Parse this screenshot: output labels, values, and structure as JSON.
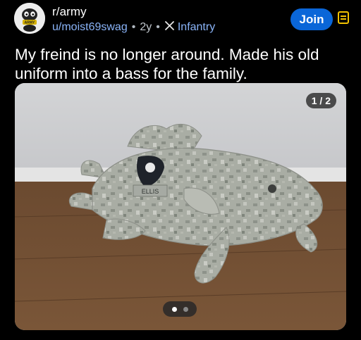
{
  "post": {
    "subreddit": "r/army",
    "author": "u/moist69swag",
    "separator": "•",
    "age": "2y",
    "flair": "Infantry",
    "title": "My freind is no longer around. Made his old uniform into a bass for the family.",
    "join_label": "Join"
  },
  "media": {
    "counter": "1 / 2",
    "patch_text": "ELLIS",
    "page_count": 2,
    "active_page": 1
  },
  "avatar": {
    "badge_text": "ARMY"
  },
  "colors": {
    "background": "#000000",
    "join_button": "#0a66d8",
    "meta_link": "#8ab4f8",
    "menu_icon": "#f2c200",
    "flair_icon": "#e0e0e0"
  },
  "icons": {
    "flair": "crossed-swords-icon",
    "menu": "menu-icon",
    "avatar": "army-mascot-avatar"
  }
}
